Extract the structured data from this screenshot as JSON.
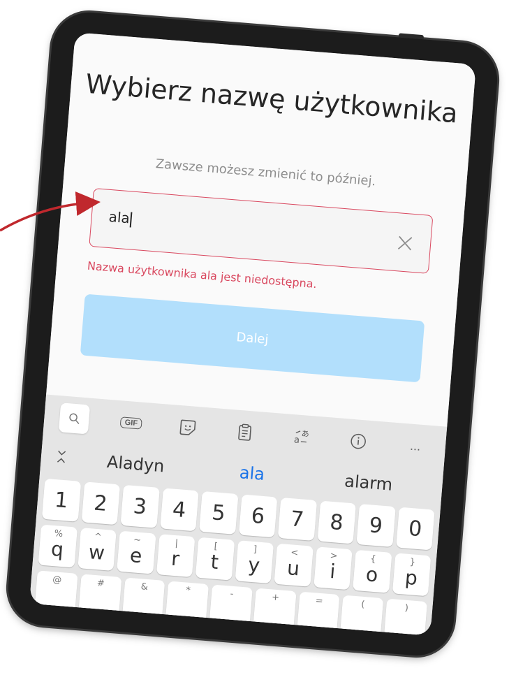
{
  "screen": {
    "title": "Wybierz nazwę użytkownika",
    "subtitle": "Zawsze możesz zmienić to później.",
    "input": {
      "value": "ala"
    },
    "error": "Nazwa użytkownika ala jest niedostępna.",
    "next_button": "Dalej"
  },
  "keyboard": {
    "toolbar": {
      "gif_label": "GIF",
      "more_label": "..."
    },
    "suggestions": [
      "Aladyn",
      "ala",
      "alarm"
    ],
    "number_row": [
      "1",
      "2",
      "3",
      "4",
      "5",
      "6",
      "7",
      "8",
      "9",
      "0"
    ],
    "letter_row": [
      {
        "key": "q",
        "alt": "%"
      },
      {
        "key": "w",
        "alt": "^"
      },
      {
        "key": "e",
        "alt": "~"
      },
      {
        "key": "r",
        "alt": "|"
      },
      {
        "key": "t",
        "alt": "["
      },
      {
        "key": "y",
        "alt": "]"
      },
      {
        "key": "u",
        "alt": "<"
      },
      {
        "key": "i",
        "alt": ">"
      },
      {
        "key": "o",
        "alt": "{"
      },
      {
        "key": "p",
        "alt": "}"
      }
    ],
    "bottom_row_alts": [
      "@",
      "#",
      "&",
      "*",
      "-",
      "+",
      "=",
      "(",
      ")"
    ]
  },
  "colors": {
    "error": "#d9485f",
    "button_disabled": "#b2dffc",
    "suggestion_active": "#1a73e8",
    "arrow": "#c0282d"
  }
}
